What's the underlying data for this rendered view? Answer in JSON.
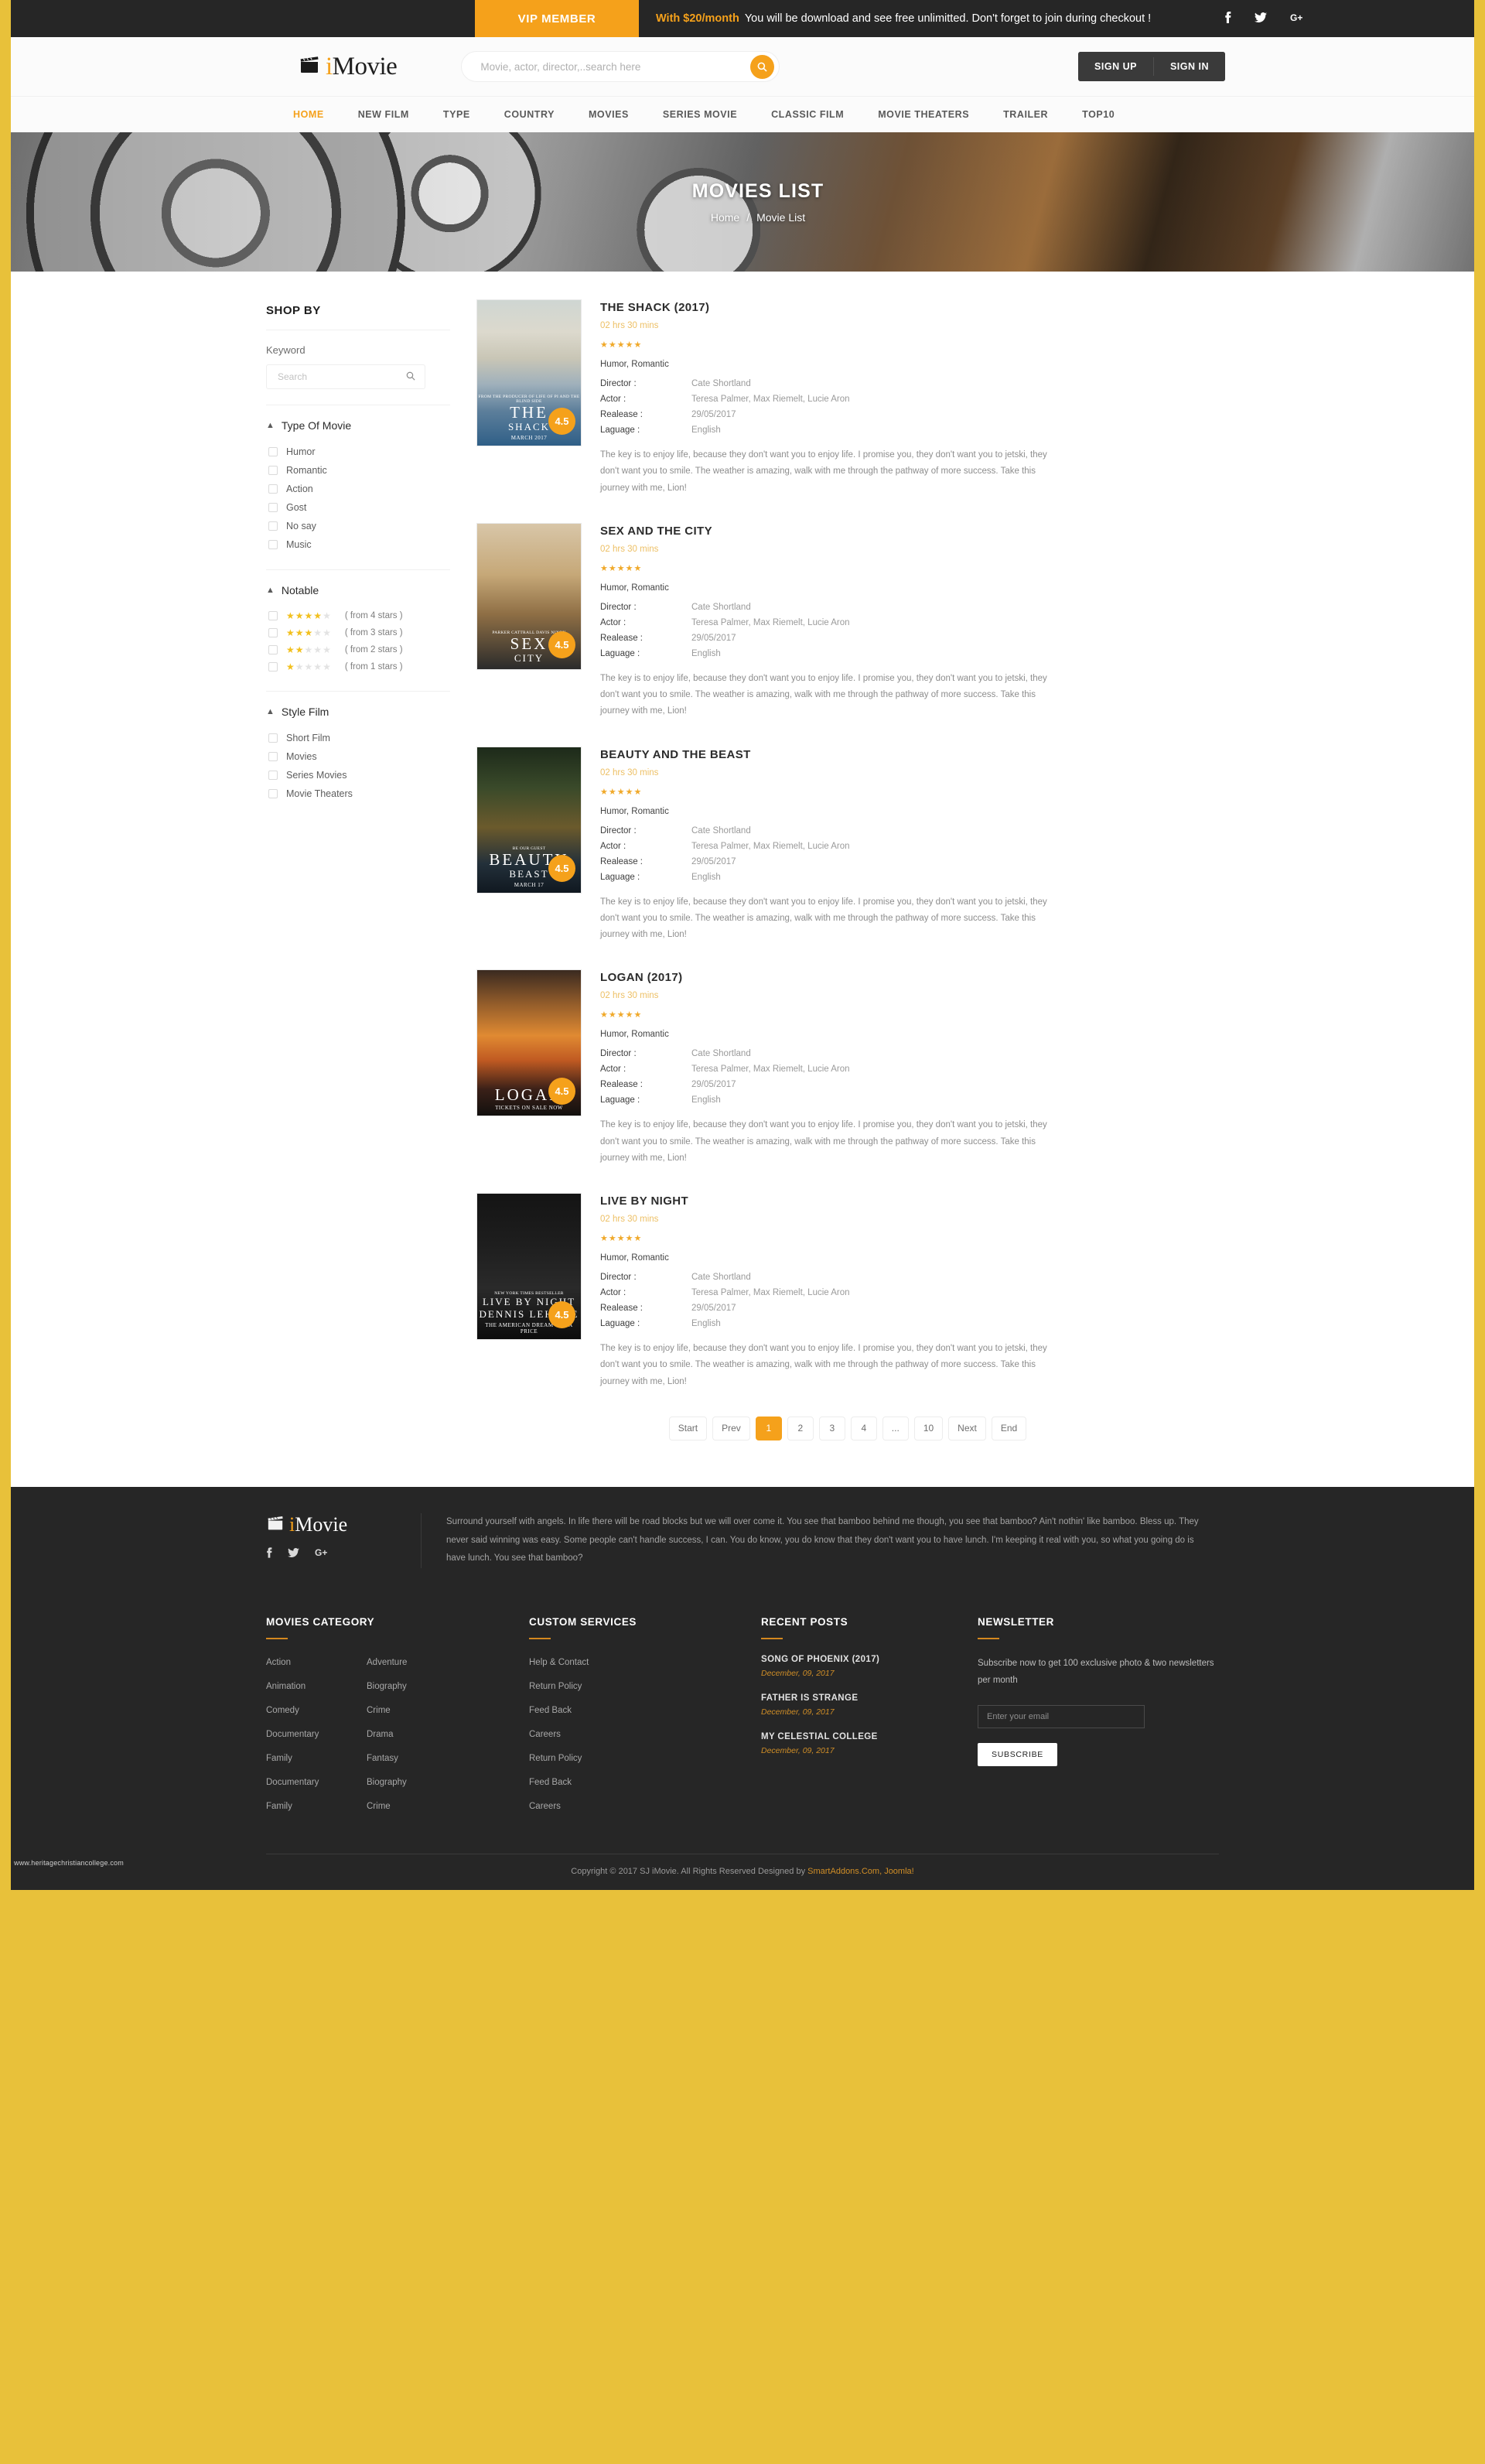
{
  "topbar": {
    "vip_label": "VIP MEMBER",
    "promo_price": "With $20/month",
    "promo_text": "You will be download and see free unlimitted. Don't forget to join during checkout !",
    "social": [
      "facebook-icon",
      "twitter-icon",
      "google-plus-icon"
    ],
    "social_glyphs": [
      "f",
      "🐦",
      "G+"
    ]
  },
  "header": {
    "logo_i": "i",
    "logo_rest": "Movie",
    "search_placeholder": "Movie, actor, director,..search here",
    "search_value": "",
    "sign_up": "SIGN UP",
    "sign_in": "SIGN IN"
  },
  "nav": {
    "items": [
      {
        "label": "HOME",
        "active": true
      },
      {
        "label": "NEW FILM",
        "active": false
      },
      {
        "label": "TYPE",
        "active": false
      },
      {
        "label": "COUNTRY",
        "active": false
      },
      {
        "label": "MOVIES",
        "active": false
      },
      {
        "label": "SERIES MOVIE",
        "active": false
      },
      {
        "label": "CLASSIC FILM",
        "active": false
      },
      {
        "label": "MOVIE THEATERS",
        "active": false
      },
      {
        "label": "TRAILER",
        "active": false
      },
      {
        "label": "TOP10",
        "active": false
      }
    ]
  },
  "hero": {
    "title": "MOVIES LIST",
    "crumb_home": "Home",
    "crumb_sep": "/",
    "crumb_current": "Movie List"
  },
  "sidebar": {
    "shop_by": "SHOP BY",
    "keyword_label": "Keyword",
    "keyword_placeholder": "Search",
    "keyword_value": "",
    "type_of_movie": {
      "title": "Type Of Movie",
      "items": [
        "Humor",
        "Romantic",
        "Action",
        "Gost",
        "No say",
        "Music"
      ]
    },
    "notable": {
      "title": "Notable",
      "items": [
        {
          "filled": 4,
          "label": "( from 4 stars )"
        },
        {
          "filled": 3,
          "label": "( from 3 stars )"
        },
        {
          "filled": 2,
          "label": "( from 2 stars )"
        },
        {
          "filled": 1,
          "label": "( from 1 stars )"
        }
      ]
    },
    "style_film": {
      "title": "Style Film",
      "items": [
        "Short Film",
        "Movies",
        "Series Movies",
        "Movie Theaters"
      ]
    }
  },
  "labels": {
    "director": "Director :",
    "actor": "Actor :",
    "release": "Realease :",
    "language": "Laguage :"
  },
  "movies": [
    {
      "title": "THE SHACK (2017)",
      "duration": "02 hrs 30 mins",
      "stars": 5,
      "genre": "Humor, Romantic",
      "director": "Cate Shortland",
      "actor": "Teresa Palmer,  Max Riemelt,  Lucie Aron",
      "release": "29/05/2017",
      "language": "English",
      "rating": "4.5",
      "description": "The key is to enjoy life, because they don't want you to enjoy life. I promise you, they don't want you to jetski, they don't want you to smile. The weather is amazing, walk with me through the pathway of more success. Take this journey with me, Lion!",
      "poster_class": "p1",
      "poster_tagline": "FROM THE PRODUCER OF LIFE OF PI AND THE BLIND SIDE",
      "poster_line1": "THE",
      "poster_line2": "SHACK",
      "poster_date": "MARCH 2017"
    },
    {
      "title": "SEX AND THE CITY",
      "duration": "02 hrs 30 mins",
      "stars": 5,
      "genre": "Humor, Romantic",
      "director": "Cate Shortland",
      "actor": "Teresa Palmer,  Max Riemelt,  Lucie Aron",
      "release": "29/05/2017",
      "language": "English",
      "rating": "4.5",
      "description": "The key is to enjoy life, because they don't want you to enjoy life. I promise you, they don't want you to jetski, they don't want you to smile. The weather is amazing, walk with me through the pathway of more success. Take this journey with me, Lion!",
      "poster_class": "p2",
      "poster_tagline": "PARKER   CATTRALL   DAVIS   NIXON",
      "poster_line1": "SEX",
      "poster_line2": "CITY",
      "poster_date": ""
    },
    {
      "title": "BEAUTY AND THE BEAST",
      "duration": "02 hrs 30 mins",
      "stars": 5,
      "genre": "Humor, Romantic",
      "director": "Cate Shortland",
      "actor": "Teresa Palmer,  Max Riemelt,  Lucie Aron",
      "release": "29/05/2017",
      "language": "English",
      "rating": "4.5",
      "description": "The key is to enjoy life, because they don't want you to enjoy life. I promise you, they don't want you to jetski, they don't want you to smile. The weather is amazing, walk with me through the pathway of more success. Take this journey with me, Lion!",
      "poster_class": "p3",
      "poster_tagline": "BE OUR GUEST",
      "poster_line1": "BEAUTY",
      "poster_line2": "BEAST",
      "poster_date": "MARCH 17"
    },
    {
      "title": "LOGAN (2017)",
      "duration": "02 hrs 30 mins",
      "stars": 5,
      "genre": "Humor, Romantic",
      "director": "Cate Shortland",
      "actor": "Teresa Palmer,  Max Riemelt,  Lucie Aron",
      "release": "29/05/2017",
      "language": "English",
      "rating": "4.5",
      "description": "The key is to enjoy life, because they don't want you to enjoy life. I promise you, they don't want you to jetski, they don't want you to smile. The weather is amazing, walk with me through the pathway of more success. Take this journey with me, Lion!",
      "poster_class": "p4",
      "poster_tagline": "",
      "poster_line1": "LOGAN",
      "poster_line2": "",
      "poster_date": "TICKETS ON SALE NOW"
    },
    {
      "title": "LIVE BY NIGHT",
      "duration": "02 hrs 30 mins",
      "stars": 5,
      "genre": "Humor, Romantic",
      "director": "Cate Shortland",
      "actor": "Teresa Palmer,  Max Riemelt,  Lucie Aron",
      "release": "29/05/2017",
      "language": "English",
      "rating": "4.5",
      "description": "The key is to enjoy life, because they don't want you to enjoy life. I promise you, they don't want you to jetski, they don't want you to smile. The weather is amazing, walk with me through the pathway of more success. Take this journey with me, Lion!",
      "poster_class": "p5",
      "poster_tagline": "NEW YORK TIMES BESTSELLER",
      "poster_line1": "LIVE BY NIGHT",
      "poster_line2": "DENNIS LEHANE",
      "poster_date": "THE AMERICAN DREAM HAS A PRICE"
    }
  ],
  "pagination": {
    "items": [
      {
        "label": "Start",
        "active": false
      },
      {
        "label": "Prev",
        "active": false
      },
      {
        "label": "1",
        "active": true
      },
      {
        "label": "2",
        "active": false
      },
      {
        "label": "3",
        "active": false
      },
      {
        "label": "4",
        "active": false
      },
      {
        "label": "...",
        "active": false
      },
      {
        "label": "10",
        "active": false
      },
      {
        "label": "Next",
        "active": false
      },
      {
        "label": "End",
        "active": false
      }
    ]
  },
  "footer": {
    "logo_i": "i",
    "logo_rest": "Movie",
    "about": "Surround yourself with angels. In life there will be road blocks but we will over come it. You see that bamboo behind me though, you see that bamboo? Ain't nothin' like bamboo. Bless up. They never said winning was easy. Some people can't handle success, I can. You do know, you do know that they don't want you to have lunch. I'm keeping it real with you, so what you going do is have lunch. You see that bamboo?",
    "movies_category": {
      "title": "MOVIES CATEGORY",
      "col1": [
        "Action",
        "Animation",
        "Comedy",
        "Documentary",
        "Family",
        "Documentary",
        "Family"
      ],
      "col2": [
        "Adventure",
        "Biography",
        "Crime",
        "Drama",
        "Fantasy",
        "Biography",
        "Crime"
      ]
    },
    "custom_services": {
      "title": "CUSTOM SERVICES",
      "items": [
        "Help & Contact",
        "Return Policy",
        "Feed Back",
        "Careers",
        "Return Policy",
        "Feed Back",
        "Careers"
      ]
    },
    "recent_posts": {
      "title": "RECENT POSTS",
      "items": [
        {
          "title": "SONG OF PHOENIX (2017)",
          "date": "December, 09, 2017"
        },
        {
          "title": "FATHER IS STRANGE",
          "date": "December, 09, 2017"
        },
        {
          "title": "MY CELESTIAL COLLEGE",
          "date": "December, 09, 2017"
        }
      ]
    },
    "newsletter": {
      "title": "NEWSLETTER",
      "text": "Subscribe now to get 100 exclusive photo & two newsletters per month",
      "placeholder": "Enter your email",
      "value": "",
      "button": "SUBSCRIBE"
    },
    "copyright_pre": "Copyright © 2017 SJ iMovie. All Rights Reserved Designed by ",
    "copyright_link": "SmartAddons.Com, Joomla!"
  },
  "watermark": "www.heritagechristiancollege.com",
  "colors": {
    "accent": "#f5a11b",
    "dark": "#262626",
    "page_border": "#e8c13a",
    "star": "#f2c01e"
  }
}
